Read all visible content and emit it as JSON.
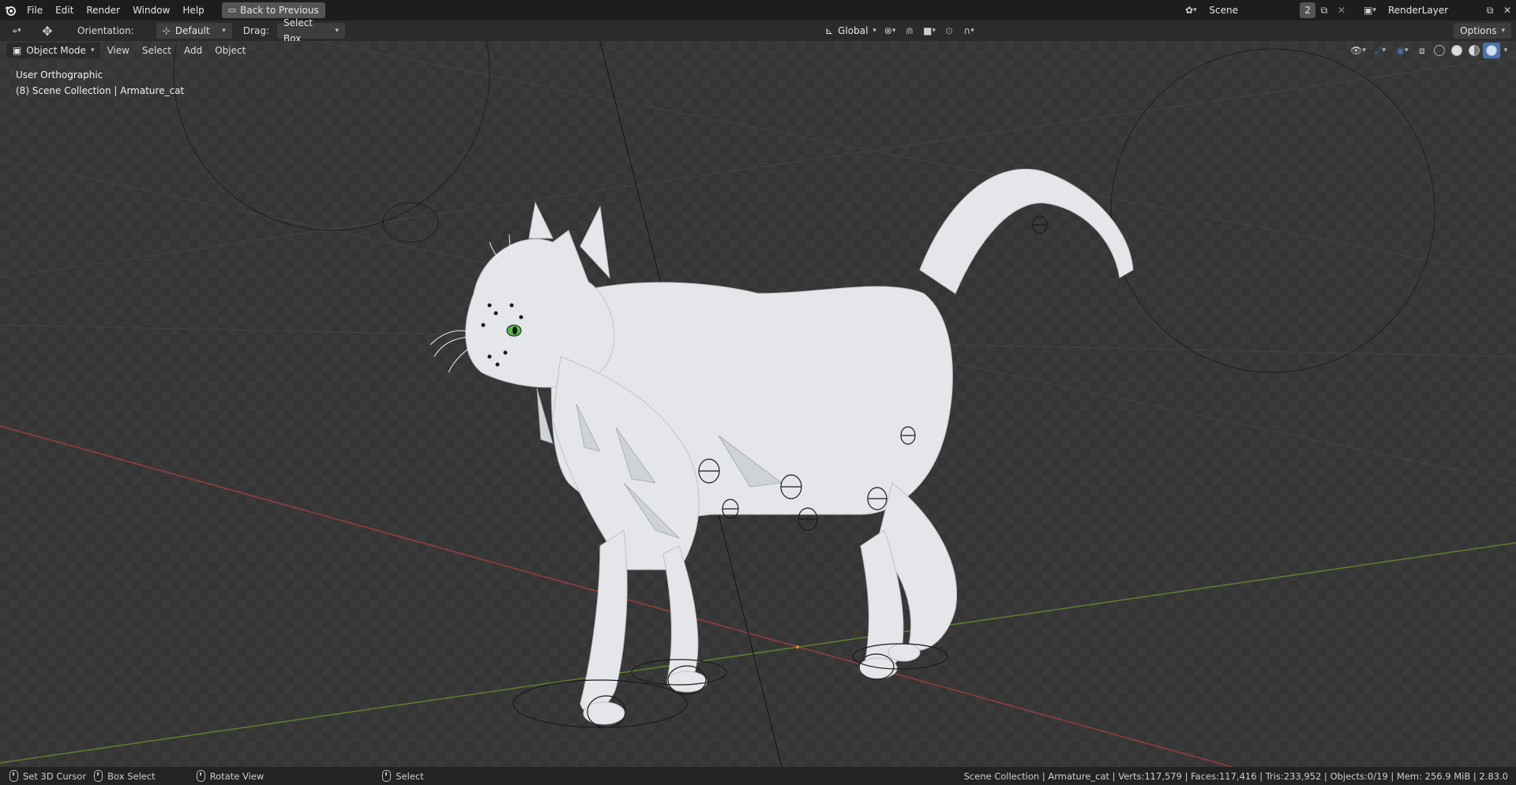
{
  "topbar": {
    "menus": [
      "File",
      "Edit",
      "Render",
      "Window",
      "Help"
    ],
    "back_button": "Back to Previous",
    "scene_name": "Scene",
    "scene_users": "2",
    "render_layer": "RenderLayer"
  },
  "toolbar": {
    "orientation_label": "Orientation:",
    "orientation_value": "Default",
    "drag_label": "Drag:",
    "drag_value": "Select Box",
    "transform_orientation": "Global",
    "options_label": "Options"
  },
  "viewport_header": {
    "mode": "Object Mode",
    "menus": [
      "View",
      "Select",
      "Add",
      "Object"
    ]
  },
  "viewport": {
    "view_name": "User Orthographic",
    "collection_info": "(8) Scene Collection | Armature_cat"
  },
  "statusbar": {
    "hint1": "Set 3D Cursor",
    "hint2": "Box Select",
    "hint3": "Rotate View",
    "hint4": "Select",
    "stats": "Scene Collection | Armature_cat | Verts:117,579 | Faces:117,416 | Tris:233,952 | Objects:0/19 | Mem: 256.9 MiB | 2.83.0"
  },
  "colors": {
    "x_axis": "#b34a4a",
    "y_axis": "#6f8f3a",
    "accent": "#4772b3"
  }
}
